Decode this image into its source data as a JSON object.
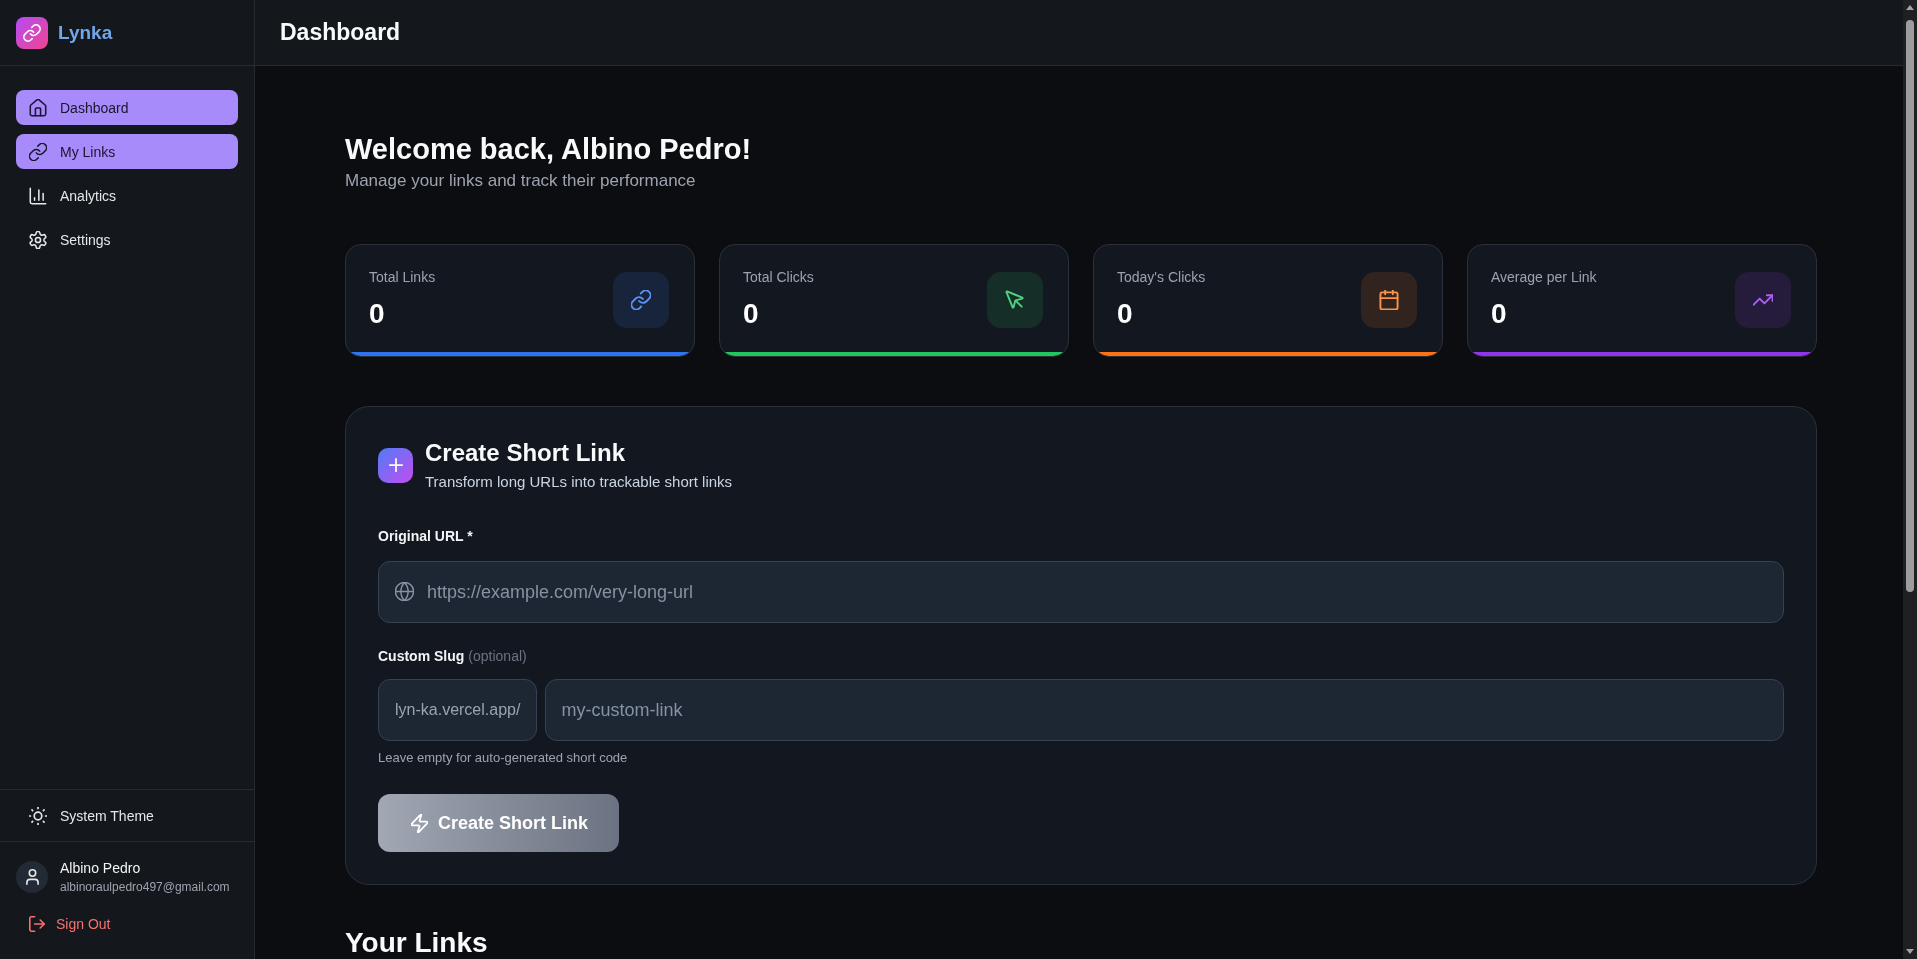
{
  "sidebar": {
    "brand": "Lynka",
    "nav": [
      {
        "label": "Dashboard",
        "selected": true
      },
      {
        "label": "My Links",
        "selected": true
      },
      {
        "label": "Analytics",
        "selected": false
      },
      {
        "label": "Settings",
        "selected": false
      }
    ],
    "theme_toggle": "System Theme",
    "user": {
      "name": "Albino Pedro",
      "email": "albinoraulpedro497@gmail.com"
    },
    "sign_out": "Sign Out"
  },
  "header": {
    "title": "Dashboard"
  },
  "welcome": {
    "title": "Welcome back, Albino Pedro!",
    "subtitle": "Manage your links and track their performance"
  },
  "stats": [
    {
      "label": "Total Links",
      "value": "0",
      "color": "#2f73f0"
    },
    {
      "label": "Total Clicks",
      "value": "0",
      "color": "#22c55e"
    },
    {
      "label": "Today's Clicks",
      "value": "0",
      "color": "#f97316"
    },
    {
      "label": "Average per Link",
      "value": "0",
      "color": "#9333ea"
    }
  ],
  "create_form": {
    "title": "Create Short Link",
    "subtitle": "Transform long URLs into trackable short links",
    "url_field": {
      "label": "Original URL *",
      "placeholder": "https://example.com/very-long-url"
    },
    "slug_field": {
      "label": "Custom Slug",
      "label_note": "(optional)",
      "prefix": "lyn-ka.vercel.app/",
      "placeholder": "my-custom-link",
      "hint": "Leave empty for auto-generated short code"
    },
    "submit": {
      "label": "Create Short Link",
      "disabled": true
    }
  },
  "links_section": {
    "title": "Your Links"
  }
}
